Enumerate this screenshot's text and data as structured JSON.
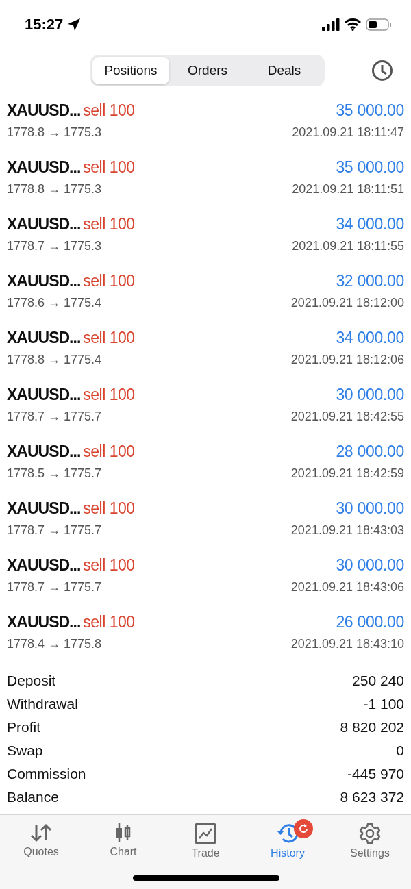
{
  "status_bar": {
    "time": "15:27"
  },
  "segments": [
    {
      "label": "Positions",
      "selected": true
    },
    {
      "label": "Orders",
      "selected": false
    },
    {
      "label": "Deals",
      "selected": false
    }
  ],
  "deals": [
    {
      "symbol": "XAUUSD...",
      "side": "sell 100",
      "prices": "1778.8 → 1775.3",
      "profit": "35 000.00",
      "time": "2021.09.21 18:11:47"
    },
    {
      "symbol": "XAUUSD...",
      "side": "sell 100",
      "prices": "1778.8 → 1775.3",
      "profit": "35 000.00",
      "time": "2021.09.21 18:11:51"
    },
    {
      "symbol": "XAUUSD...",
      "side": "sell 100",
      "prices": "1778.7 → 1775.3",
      "profit": "34 000.00",
      "time": "2021.09.21 18:11:55"
    },
    {
      "symbol": "XAUUSD...",
      "side": "sell 100",
      "prices": "1778.6 → 1775.4",
      "profit": "32 000.00",
      "time": "2021.09.21 18:12:00"
    },
    {
      "symbol": "XAUUSD...",
      "side": "sell 100",
      "prices": "1778.8 → 1775.4",
      "profit": "34 000.00",
      "time": "2021.09.21 18:12:06"
    },
    {
      "symbol": "XAUUSD...",
      "side": "sell 100",
      "prices": "1778.7 → 1775.7",
      "profit": "30 000.00",
      "time": "2021.09.21 18:42:55"
    },
    {
      "symbol": "XAUUSD...",
      "side": "sell 100",
      "prices": "1778.5 → 1775.7",
      "profit": "28 000.00",
      "time": "2021.09.21 18:42:59"
    },
    {
      "symbol": "XAUUSD...",
      "side": "sell 100",
      "prices": "1778.7 → 1775.7",
      "profit": "30 000.00",
      "time": "2021.09.21 18:43:03"
    },
    {
      "symbol": "XAUUSD...",
      "side": "sell 100",
      "prices": "1778.7 → 1775.7",
      "profit": "30 000.00",
      "time": "2021.09.21 18:43:06"
    },
    {
      "symbol": "XAUUSD...",
      "side": "sell 100",
      "prices": "1778.4 → 1775.8",
      "profit": "26 000.00",
      "time": "2021.09.21 18:43:10"
    }
  ],
  "summary": [
    {
      "label": "Deposit",
      "value": "250 240"
    },
    {
      "label": "Withdrawal",
      "value": "-1 100"
    },
    {
      "label": "Profit",
      "value": "8 820 202"
    },
    {
      "label": "Swap",
      "value": "0"
    },
    {
      "label": "Commission",
      "value": "-445 970"
    },
    {
      "label": "Balance",
      "value": "8 623 372"
    }
  ],
  "tab_bar": [
    {
      "kind": "quotes",
      "label": "Quotes",
      "selected": false,
      "badge": false
    },
    {
      "kind": "chart",
      "label": "Chart",
      "selected": false,
      "badge": false
    },
    {
      "kind": "trade",
      "label": "Trade",
      "selected": false,
      "badge": false
    },
    {
      "kind": "history",
      "label": "History",
      "selected": true,
      "badge": true
    },
    {
      "kind": "settings",
      "label": "Settings",
      "selected": false,
      "badge": false
    }
  ]
}
